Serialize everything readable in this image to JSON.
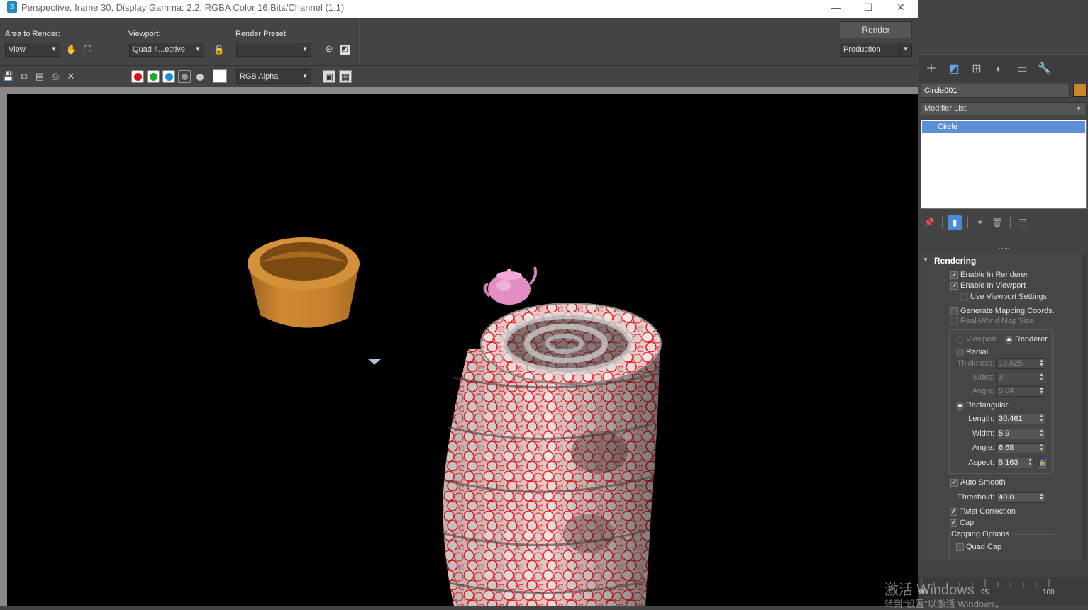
{
  "window": {
    "title": "Perspective, frame 30, Display Gamma: 2.2, RGBA Color 16 Bits/Channel (1:1)",
    "app_icon": "3",
    "minimize": "—",
    "maximize": "☐",
    "close": "✕"
  },
  "toolbar": {
    "area_label": "Area to Render:",
    "area_value": "View",
    "viewport_label": "Viewport:",
    "viewport_value": "Quad 4...ective",
    "preset_label": "Render Preset:",
    "preset_value": "",
    "render_button": "Render",
    "production_value": "Production"
  },
  "channels": {
    "display_value": "RGB Alpha",
    "colors": {
      "red": "#e01010",
      "green": "#22aa22",
      "blue": "#1a8fe0"
    }
  },
  "command_panel": {
    "object_name": "Circle001",
    "object_color": "#c8862c",
    "modifier_list": "Modifier List",
    "stack_item": "Circle"
  },
  "rendering": {
    "header": "Rendering",
    "enable_in_renderer": "Enable In Renderer",
    "enable_in_viewport": "Enable In Viewport",
    "use_viewport_settings": "Use Viewport Settings",
    "generate_mapping": "Generate Mapping Coords.",
    "real_world": "Real-World Map Size",
    "viewport_radio": "Viewport",
    "renderer_radio": "Renderer",
    "radial": "Radial",
    "thickness_label": "Thickness:",
    "thickness": "13.625",
    "sides_label": "Sides:",
    "sides": "3",
    "angle_label": "Angle:",
    "angle_radial": "5.04",
    "rectangular": "Rectangular",
    "length_label": "Length:",
    "length": "30.461",
    "width_label": "Width:",
    "width": "5.9",
    "angle_rect": "6.68",
    "aspect_label": "Aspect:",
    "aspect": "5.163",
    "auto_smooth": "Auto Smooth",
    "threshold_label": "Threshold:",
    "threshold": "40.0",
    "twist_correction": "Twist Correction",
    "cap": "Cap",
    "capping_options": "Capping Options",
    "quad_cap": "Quad Cap"
  },
  "timeline": {
    "ticks": [
      "90",
      "95",
      "100"
    ]
  },
  "watermark": {
    "line1": "激活 Windows",
    "line2": "转到“设置”以激活 Windows。"
  }
}
